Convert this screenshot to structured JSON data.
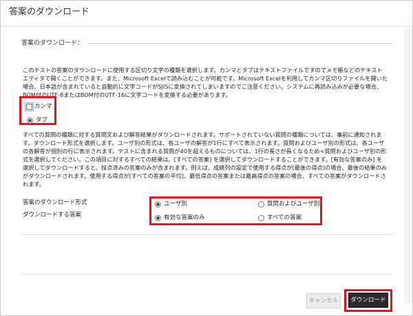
{
  "window": {
    "title": "答案のダウンロード"
  },
  "section": {
    "title": "答案のダウンロード："
  },
  "delimiter": {
    "description": "このテストの答案のダウンロードに使用する区切り文字の種類を選択します。カンマとタブはテキストファイルですのでメモ帳などのテキストエディタで開くことができます。また、Microsoft Excelで読み込むことが可能です。Microsoft Excelを利用してカンマ区切りファイルを開いた場合、日本語が含まれていると自動的に文字コードがSJISに変換されてしまいますのでご注意ください。システムに再読み込みが必要な場合、BOM付のUTF-8またはBOM付のUTF-16に文字コードを変換する必要があります。",
    "options": [
      {
        "label": "カンマ",
        "selected": false
      },
      {
        "label": "タブ",
        "selected": true
      }
    ]
  },
  "format_info": {
    "description": "すべての質問の種類に対する質問文および解答結果がダウンロードされます。サポートされていない質問の種類については、事前に通知されます。ダウンロード形式を選択します。ユーザ別の形式は、各ユーザの解答が1行にすべて表示されます。質問およびユーザ別の形式は、各ユーザの各解答が個別の行に表示されます。テストに含まれる質問が40を超えるものについては、1行の長さが長くなるため<質問およびユーザ別の形式を選択してください。この項目に対するすべての結果は、[すべての答案] を選択してダウンロードすることができます。[有効な答案のみ] を選択してダウンロードすると、採点済みの答案のみが含まれます。例えば、成績列の設定で使用する得点が[最後の得点]の場合、最後の結果のみがダウンロードされます。使用する得点が[すべての答案の平均]、最低得点の答案または最高得点の答案の場合、すべての答案がダウンロードされます。"
  },
  "form": {
    "format_label": "答案のダウンロード形式",
    "attempts_label": "ダウンロードする答案",
    "format_options": [
      {
        "label": "ユーザ別",
        "selected": true
      },
      {
        "label": "質問およびユーザ別",
        "selected": false
      }
    ],
    "attempt_options": [
      {
        "label": "有効な答案のみ",
        "selected": true
      },
      {
        "label": "すべての答案",
        "selected": false
      }
    ]
  },
  "buttons": {
    "cancel": "キャンセル",
    "download": "ダウンロード"
  },
  "colors": {
    "highlight": "#e8101e",
    "primary_button": "#2b2b2b"
  }
}
